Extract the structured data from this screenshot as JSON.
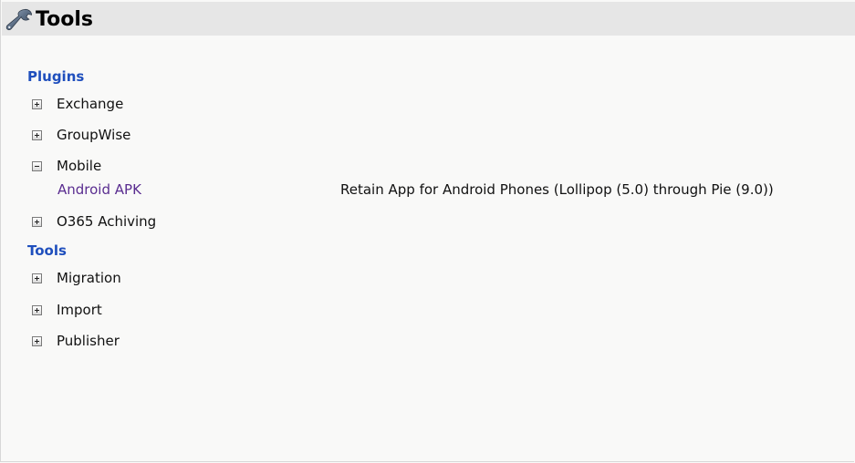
{
  "header": {
    "title": "Tools",
    "icon": "wrench-icon"
  },
  "sections": {
    "plugins": {
      "label": "Plugins",
      "items": [
        {
          "label": "Exchange",
          "state": "collapsed"
        },
        {
          "label": "GroupWise",
          "state": "collapsed"
        },
        {
          "label": "Mobile",
          "state": "expanded",
          "children": [
            {
              "link": "Android APK",
              "description": "Retain App for Android Phones (Lollipop (5.0) through Pie (9.0))"
            }
          ]
        },
        {
          "label": "O365 Achiving",
          "state": "collapsed"
        }
      ]
    },
    "tools": {
      "label": "Tools",
      "items": [
        {
          "label": "Migration",
          "state": "collapsed"
        },
        {
          "label": "Import",
          "state": "collapsed"
        },
        {
          "label": "Publisher",
          "state": "collapsed"
        }
      ]
    }
  },
  "colors": {
    "section_heading": "#1f4fbd",
    "link": "#5a2d90",
    "titlebar_bg": "#e6e6e6",
    "page_bg": "#f9f9f8"
  }
}
